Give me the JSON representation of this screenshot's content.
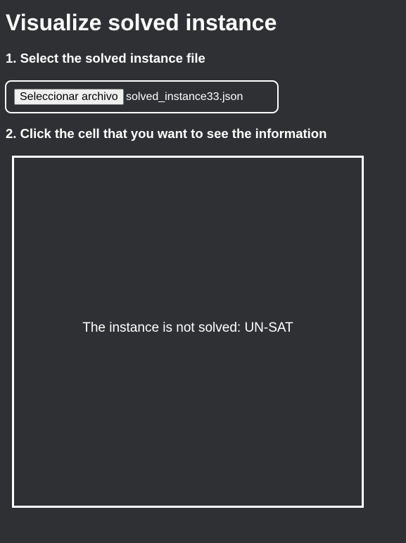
{
  "page": {
    "title": "Visualize solved instance"
  },
  "step1": {
    "label": "1. Select the solved instance file",
    "file_input": {
      "button_label": "Seleccionar archivo",
      "file_name": "solved_instance33.json"
    }
  },
  "step2": {
    "label": "2. Click the cell that you want to see the information"
  },
  "canvas": {
    "message": "The instance is not solved: UN-SAT"
  },
  "colors": {
    "background": "#2f3033",
    "text": "#ffffff",
    "border": "#ffffff",
    "button_background": "#efefef"
  }
}
